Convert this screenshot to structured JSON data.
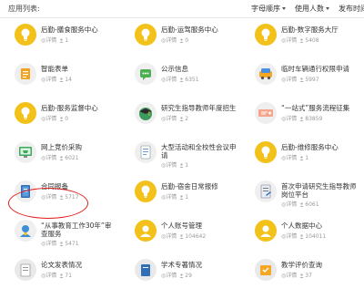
{
  "header": {
    "title": "应用列表:",
    "sort_alpha": "字母顺序",
    "sort_usage": "使用人数",
    "sort_time": "发布时间"
  },
  "detail_label": "详情",
  "highlight_color": "#e0201b",
  "apps": [
    {
      "name": "后勤-膳食服务中心",
      "users": "1",
      "icon": "lightbulb-yellow-icon"
    },
    {
      "name": "后勤-运驾服务中心",
      "users": "0",
      "icon": "lightbulb-yellow-icon"
    },
    {
      "name": "后勤-数字服务大厅",
      "users": "5408",
      "icon": "lightbulb-yellow-icon"
    },
    {
      "name": "智能表单",
      "users": "14",
      "icon": "smart-form-icon"
    },
    {
      "name": "公示信息",
      "users": "6351",
      "icon": "chat-bubble-icon"
    },
    {
      "name": "临时车辆通行权限申请",
      "users": "5997",
      "icon": "vehicle-pass-icon"
    },
    {
      "name": "后勤-服务监督中心",
      "users": "0",
      "icon": "lightbulb-yellow-icon"
    },
    {
      "name": "研究生指导教师年度招生",
      "users": "2",
      "icon": "graduation-cap-icon"
    },
    {
      "name": "“一站式”服务流程征集",
      "users": "83859",
      "icon": "ticket-icon"
    },
    {
      "name": "网上竞价采购",
      "users": "6021",
      "icon": "monitor-cart-icon"
    },
    {
      "name": "大型活动和全校性会议申请",
      "users": "1",
      "icon": "document-list-icon"
    },
    {
      "name": "后勤-维修服务中心",
      "users": "1",
      "icon": "lightbulb-yellow-icon"
    },
    {
      "name": "合同报备",
      "users": "5717",
      "icon": "contract-book-icon"
    },
    {
      "name": "后勤-宿舍日常报修",
      "users": "1",
      "icon": "lightbulb-yellow-icon"
    },
    {
      "name": "首次申请研究生指导教师岗位平台",
      "users": "6061",
      "icon": "application-form-icon"
    },
    {
      "name": "“从事教育工作30年”审查服务",
      "users": "5471",
      "icon": "teacher-badge-icon"
    },
    {
      "name": "个人账号管理",
      "users": "104642",
      "icon": "person-icon"
    },
    {
      "name": "个人数据中心",
      "users": "104011",
      "icon": "person-icon"
    },
    {
      "name": "论文发表情况",
      "users": "71",
      "icon": "paper-icon"
    },
    {
      "name": "学术专著情况",
      "users": "29",
      "icon": "book-icon"
    },
    {
      "name": "教学评价查询",
      "users": "37",
      "icon": "evaluation-icon"
    }
  ]
}
